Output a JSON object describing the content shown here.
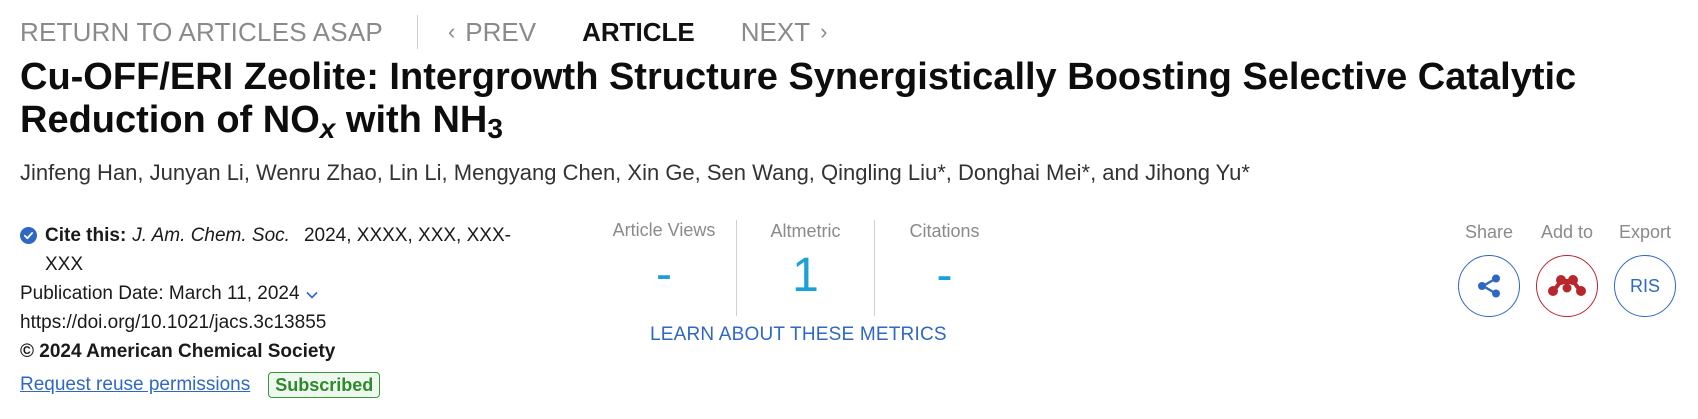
{
  "nav": {
    "return_label": "RETURN TO ARTICLES ASAP",
    "prev_label": "PREV",
    "article_label": "ARTICLE",
    "next_label": "NEXT"
  },
  "article": {
    "title_part1": "Cu-OFF/ERI Zeolite: Intergrowth Structure Synergistically Boosting Selective Catalytic Reduction of NO",
    "title_sub_x": "x",
    "title_part2": " with NH",
    "title_sub_3": "3",
    "authors": "Jinfeng Han, Junyan Li, Wenru Zhao, Lin Li, Mengyang Chen, Xin Ge, Sen Wang, Qingling Liu*, Donghai Mei*, and Jihong Yu*"
  },
  "citation": {
    "cite_label": "Cite this:",
    "journal": "J. Am. Chem. Soc.",
    "cite_rest": "2024, XXXX, XXX, XXX-XXX",
    "pub_date": "Publication Date: March 11, 2024",
    "doi": "https://doi.org/10.1021/jacs.3c13855",
    "copyright": "© 2024 American Chemical Society",
    "reuse_link": "Request reuse permissions",
    "badge": "Subscribed"
  },
  "metrics": {
    "views_label": "Article Views",
    "views_value": "-",
    "altmetric_label": "Altmetric",
    "altmetric_value": "1",
    "citations_label": "Citations",
    "citations_value": "-",
    "learn_link": "LEARN ABOUT THESE METRICS"
  },
  "actions": {
    "share_label": "Share",
    "add_label": "Add to",
    "export_label": "Export",
    "ris_label": "RIS"
  },
  "colors": {
    "accent_blue": "#2f67c4",
    "metric_blue": "#1ba0d8",
    "mendeley_red": "#b8262e",
    "subscribed_green": "#2d8a2d"
  },
  "icons": [
    "chevron-left-icon",
    "chevron-right-icon",
    "check-circle-icon",
    "chevron-down-icon",
    "share-icon",
    "mendeley-icon"
  ]
}
